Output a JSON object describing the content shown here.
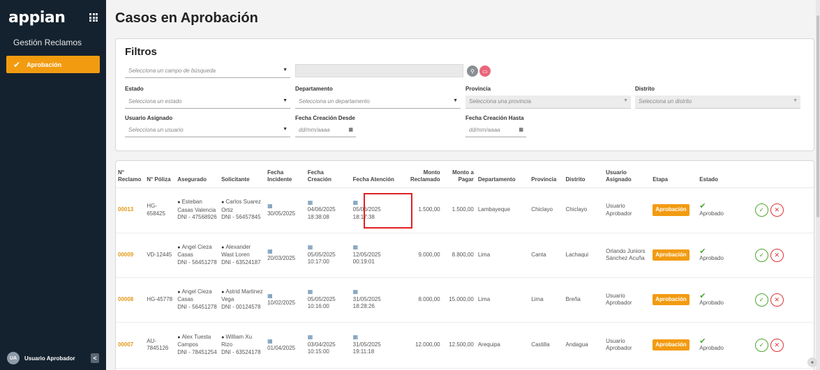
{
  "sidebar": {
    "logo": "appian",
    "section": "Gestión Reclamos",
    "active_item": "Aprobación",
    "user_initials": "UA",
    "user_name": "Usuario Aprobador",
    "collapse_glyph": "<"
  },
  "page": {
    "title": "Casos en Aprobación"
  },
  "filters": {
    "title": "Filtros",
    "search_field_placeholder": "Selecciona un campo de búsqueda",
    "search_value": "",
    "estado_label": "Estado",
    "estado_placeholder": "Selecciona un estado",
    "departamento_label": "Departamento",
    "departamento_placeholder": "Selecciona un departamento",
    "provincia_label": "Provincia",
    "provincia_placeholder": "Selecciona una provincia",
    "distrito_label": "Distrito",
    "distrito_placeholder": "Selecciona un distrito",
    "usuario_label": "Usuario Asignado",
    "usuario_placeholder": "Selecciona un usuario",
    "fecha_desde_label": "Fecha Creación Desde",
    "fecha_desde_placeholder": "dd/mm/aaaa",
    "fecha_hasta_label": "Fecha Creación Hasta",
    "fecha_hasta_placeholder": "dd/mm/aaaa"
  },
  "table": {
    "headers": [
      "N° Reclamo",
      "N° Póliza",
      "Asegurado",
      "Solicitante",
      "Fecha Incidente",
      "Fecha Creación",
      "Fecha Atención",
      "Monto Reclamado",
      "Monto a Pagar",
      "Departamento",
      "Provincia",
      "Distrito",
      "Usuario Asignado",
      "Etapa",
      "Estado"
    ],
    "rows": [
      {
        "reclamo": "00013",
        "poliza": "HG-658425",
        "asegurado": "Esteban Casas Valencia",
        "asegurado_dni": "DNI - 47568926",
        "solicitante": "Carlos Suarez Ortiz",
        "solicitante_dni": "DNI - 56457845",
        "incidente": "30/05/2025",
        "creacion": "04/06/2025 18:38:08",
        "atencion": "05/06/2025 18:17:38",
        "reclamado": "1.500,00",
        "pagar": "1.500,00",
        "departamento": "Lambayeque",
        "provincia": "Chiclayo",
        "distrito": "Chiclayo",
        "usuario": "Usuario Aprobador",
        "etapa": "Aprobación",
        "estado": "Aprobado"
      },
      {
        "reclamo": "00009",
        "poliza": "VD-12445",
        "asegurado": "Angel Cieza Casas",
        "asegurado_dni": "DNI - 56451278",
        "solicitante": "Alexander Wast Loren",
        "solicitante_dni": "DNI - 63524187",
        "incidente": "20/03/2025",
        "creacion": "05/05/2025 10:17:00",
        "atencion": "12/05/2025 00:19:01",
        "reclamado": "9.000,00",
        "pagar": "8.800,00",
        "departamento": "Lima",
        "provincia": "Canta",
        "distrito": "Lachaqui",
        "usuario": "Orlando Juniors Sánchez Acuña",
        "etapa": "Aprobación",
        "estado": "Aprobado"
      },
      {
        "reclamo": "00008",
        "poliza": "HG-45778",
        "asegurado": "Angel Cieza Casas",
        "asegurado_dni": "DNI - 56451278",
        "solicitante": "Astrid Martinez Vega",
        "solicitante_dni": "DNI - 00124578",
        "incidente": "10/02/2025",
        "creacion": "05/05/2025 10:16:00",
        "atencion": "31/05/2025 18:28:26",
        "reclamado": "8.000,00",
        "pagar": "15.000,00",
        "departamento": "Lima",
        "provincia": "Lima",
        "distrito": "Breña",
        "usuario": "Usuario Aprobador",
        "etapa": "Aprobación",
        "estado": "Aprobado"
      },
      {
        "reclamo": "00007",
        "poliza": "AU-7845126",
        "asegurado": "Alex Tuesta Campos",
        "asegurado_dni": "DNI - 78451254",
        "solicitante": "William Xu Rizo",
        "solicitante_dni": "DNI - 63524178",
        "incidente": "01/04/2025",
        "creacion": "03/04/2025 10:15:00",
        "atencion": "31/05/2025 19:11:18",
        "reclamado": "12.000,00",
        "pagar": "12.500,00",
        "departamento": "Arequipa",
        "provincia": "Castilla",
        "distrito": "Andagua",
        "usuario": "Usuario Aprobador",
        "etapa": "Aprobación",
        "estado": "Aprobado"
      }
    ]
  },
  "icons": {
    "apps": "grid-icon",
    "check": "checkmark-icon",
    "search": "search-icon",
    "clear": "trash-icon",
    "calendar": "calendar-icon",
    "person": "person-icon",
    "approve": "approve-icon",
    "reject": "reject-icon"
  },
  "colors": {
    "sidebar": "#14222f",
    "accent": "#f29b11",
    "search_btn": "#8a8f94",
    "clear_btn": "#e8677a",
    "ok": "#4aa52e",
    "reject": "#dd3333",
    "highlight": "#e02020"
  }
}
